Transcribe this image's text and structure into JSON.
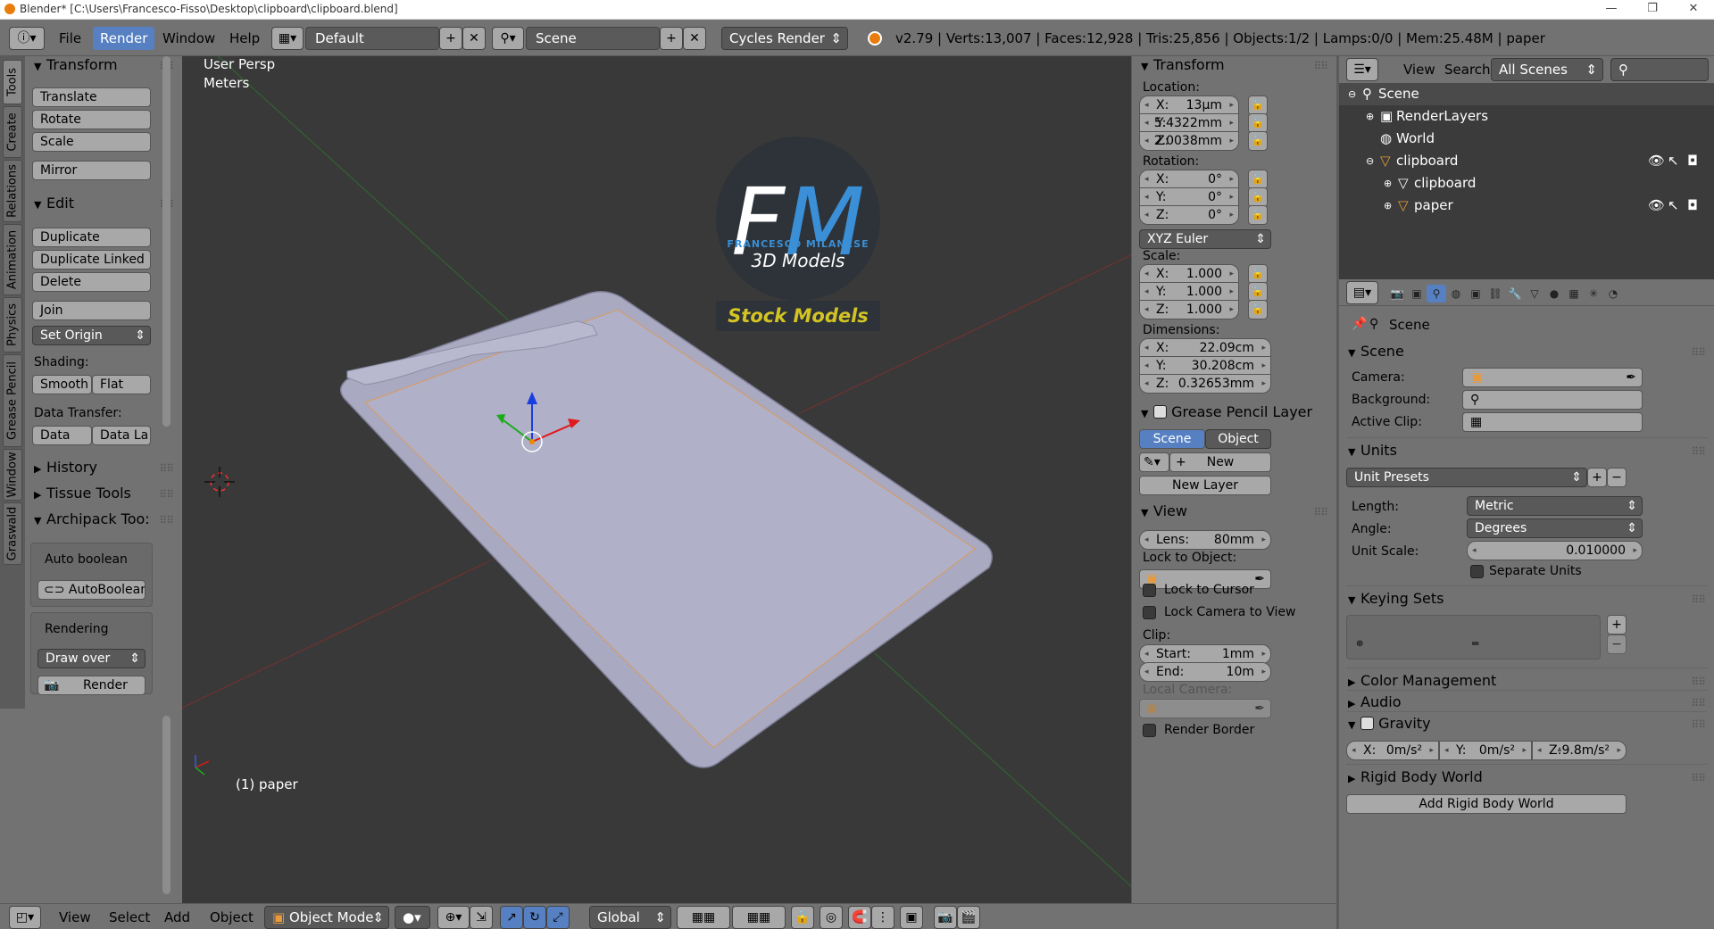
{
  "window": {
    "title": "Blender* [C:\\Users\\Francesco-Fisso\\Desktop\\clipboard\\clipboard.blend]",
    "controls": [
      "—",
      "❐",
      "✕"
    ]
  },
  "menubar": {
    "menus": [
      "File",
      "Render",
      "Window",
      "Help"
    ],
    "layout": "Default",
    "scene": "Scene",
    "engine": "Cycles Render",
    "stats": "v2.79 | Verts:13,007 | Faces:12,928 | Tris:25,856 | Objects:1/2 | Lamps:0/0 | Mem:25.48M | paper"
  },
  "vtabs": [
    "Tools",
    "Create",
    "Relations",
    "Animation",
    "Physics",
    "Grease Pencil",
    "Window",
    "Graswald"
  ],
  "toolshelf": {
    "transform_title": "Transform",
    "transform": [
      "Translate",
      "Rotate",
      "Scale",
      "Mirror"
    ],
    "edit_title": "Edit",
    "edit": [
      "Duplicate",
      "Duplicate Linked",
      "Delete",
      "Join"
    ],
    "set_origin": "Set Origin",
    "shading_label": "Shading:",
    "smooth": "Smooth",
    "flat": "Flat",
    "data_transfer_label": "Data Transfer:",
    "data": "Data",
    "data_la": "Data La",
    "history": "History",
    "tissue": "Tissue Tools",
    "archipack": "Archipack Too:",
    "auto_boolean_label": "Auto boolean",
    "autoboolean": "AutoBoolean",
    "rendering_label": "Rendering",
    "draw_over": "Draw over",
    "render": "Render"
  },
  "viewport": {
    "view_name": "User Persp",
    "units": "Meters",
    "object_label": "(1) paper",
    "logo_letters": "FM",
    "logo_name": "FRANCESCO MILANESE",
    "logo_sub": "3D Models",
    "logo_banner": "Stock Models"
  },
  "npanel": {
    "transform_title": "Transform",
    "location_label": "Location:",
    "location": [
      {
        "k": "X:",
        "v": "13µm"
      },
      {
        "k": "Y:",
        "v": "5.4322mm"
      },
      {
        "k": "Z:",
        "v": "2.0038mm"
      }
    ],
    "rotation_label": "Rotation:",
    "rotation": [
      {
        "k": "X:",
        "v": "0°"
      },
      {
        "k": "Y:",
        "v": "0°"
      },
      {
        "k": "Z:",
        "v": "0°"
      }
    ],
    "rotation_mode": "XYZ Euler",
    "scale_label": "Scale:",
    "scale": [
      {
        "k": "X:",
        "v": "1.000"
      },
      {
        "k": "Y:",
        "v": "1.000"
      },
      {
        "k": "Z:",
        "v": "1.000"
      }
    ],
    "dimensions_label": "Dimensions:",
    "dimensions": [
      {
        "k": "X:",
        "v": "22.09cm"
      },
      {
        "k": "Y:",
        "v": "30.208cm"
      },
      {
        "k": "Z:",
        "v": "0.32653mm"
      }
    ],
    "gp_title": "Grease Pencil Layer",
    "gp_scene": "Scene",
    "gp_object": "Object",
    "gp_new": "New",
    "gp_new_layer": "New Layer",
    "view_title": "View",
    "lens_label": "Lens:",
    "lens": "80mm",
    "lock_to_object": "Lock to Object:",
    "lock_to_cursor": "Lock to Cursor",
    "lock_camera": "Lock Camera to View",
    "clip_label": "Clip:",
    "clip_start_k": "Start:",
    "clip_start": "1mm",
    "clip_end_k": "End:",
    "clip_end": "10m",
    "local_camera": "Local Camera:",
    "render_border": "Render Border"
  },
  "outliner": {
    "view": "View",
    "search": "Search",
    "filter": "All Scenes",
    "rows": [
      "Scene",
      "RenderLayers",
      "World",
      "clipboard",
      "clipboard",
      "paper"
    ]
  },
  "properties": {
    "context": "Scene",
    "scene_title": "Scene",
    "camera_label": "Camera:",
    "background_label": "Background:",
    "active_clip_label": "Active Clip:",
    "units_title": "Units",
    "unit_presets": "Unit Presets",
    "length_label": "Length:",
    "length": "Metric",
    "angle_label": "Angle:",
    "angle": "Degrees",
    "unit_scale_label": "Unit Scale:",
    "unit_scale": "0.010000",
    "separate_units": "Separate Units",
    "keying_title": "Keying Sets",
    "color_mgmt": "Color Management",
    "audio": "Audio",
    "gravity": "Gravity",
    "grav_x_k": "X:",
    "grav_x": "0m/s²",
    "grav_y_k": "Y:",
    "grav_y": "0m/s²",
    "grav_z_k": "Z:",
    "grav_z": "-9.8m/s²",
    "rigid_title": "Rigid Body World",
    "add_rigid": "Add Rigid Body World"
  },
  "bottombar": {
    "menus": [
      "View",
      "Select",
      "Add",
      "Object"
    ],
    "mode": "Object Mode",
    "orientation": "Global"
  },
  "colors": {
    "accent": "#5680c2",
    "panel": "#727272",
    "viewport": "#393939",
    "logo_yellow": "#d4c423",
    "logo_blue": "#3a8fd6"
  }
}
